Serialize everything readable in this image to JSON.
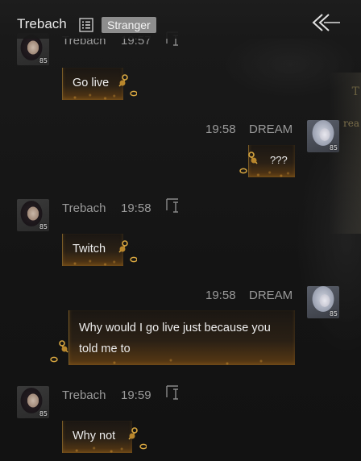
{
  "header": {
    "title": "Trebach",
    "badge": "Stranger"
  },
  "messages": [
    {
      "sender": "Trebach",
      "time": "19:57",
      "text": "Go live",
      "avatar_level": "85"
    },
    {
      "sender": "DREAM",
      "time": "19:58",
      "text": "???",
      "avatar_level": "85"
    },
    {
      "sender": "Trebach",
      "time": "19:58",
      "text": "Twitch",
      "avatar_level": "85"
    },
    {
      "sender": "DREAM",
      "time": "19:58",
      "text_line1": "Why would I go live just because you",
      "text_line2": "told me to",
      "avatar_level": "85"
    },
    {
      "sender": "Trebach",
      "time": "19:59",
      "text": "Why not",
      "avatar_level": "85"
    }
  ],
  "background": {
    "edge_text_1": "T",
    "edge_text_2": "rea"
  },
  "colors": {
    "accent_gold": "#c89a3a",
    "badge_bg": "#8d8d8d",
    "meta_text": "#9a9a9a"
  }
}
